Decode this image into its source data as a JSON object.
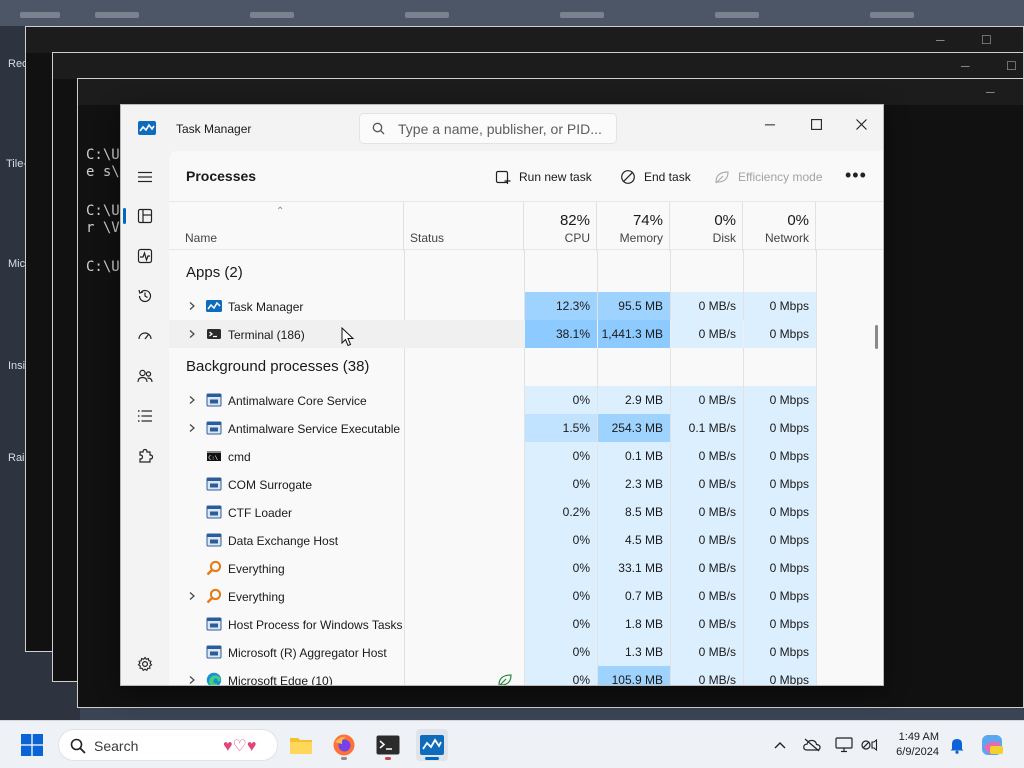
{
  "background": {
    "desktop_labels": [
      "Recycle",
      "Tile-Gr",
      "Micro",
      "Insi",
      "Rai"
    ],
    "terminal_lines": [
      "C:\\U",
      "e s\\",
      "C:\\U",
      "r \\V",
      "C:\\U"
    ]
  },
  "window": {
    "title": "Task Manager",
    "search_placeholder": "Type a name, publisher, or PID..."
  },
  "page": {
    "title": "Processes",
    "commands": {
      "run_new_task": "Run new task",
      "end_task": "End task",
      "efficiency_mode": "Efficiency mode"
    }
  },
  "columns": {
    "name": "Name",
    "status": "Status",
    "cpu": {
      "pct": "82%",
      "label": "CPU"
    },
    "memory": {
      "pct": "74%",
      "label": "Memory"
    },
    "disk": {
      "pct": "0%",
      "label": "Disk"
    },
    "network": {
      "pct": "0%",
      "label": "Network"
    }
  },
  "groups": {
    "apps": "Apps (2)",
    "background": "Background processes (38)"
  },
  "apps": [
    {
      "name": "Task Manager",
      "cpu": "12.3%",
      "memory": "95.5 MB",
      "disk": "0 MB/s",
      "network": "0 Mbps",
      "icon": "task-manager-icon"
    },
    {
      "name": "Terminal (186)",
      "cpu": "38.1%",
      "memory": "1,441.3 MB",
      "disk": "0 MB/s",
      "network": "0 Mbps",
      "icon": "terminal-icon"
    }
  ],
  "background_processes": [
    {
      "name": "Antimalware Core Service",
      "cpu": "0%",
      "memory": "2.9 MB",
      "disk": "0 MB/s",
      "network": "0 Mbps",
      "expandable": true,
      "icon": "app-window-icon"
    },
    {
      "name": "Antimalware Service Executable",
      "cpu": "1.5%",
      "memory": "254.3 MB",
      "disk": "0.1 MB/s",
      "network": "0 Mbps",
      "expandable": true,
      "icon": "app-window-icon"
    },
    {
      "name": "cmd",
      "cpu": "0%",
      "memory": "0.1 MB",
      "disk": "0 MB/s",
      "network": "0 Mbps",
      "expandable": false,
      "icon": "cmd-icon"
    },
    {
      "name": "COM Surrogate",
      "cpu": "0%",
      "memory": "2.3 MB",
      "disk": "0 MB/s",
      "network": "0 Mbps",
      "expandable": false,
      "icon": "app-window-icon"
    },
    {
      "name": "CTF Loader",
      "cpu": "0.2%",
      "memory": "8.5 MB",
      "disk": "0 MB/s",
      "network": "0 Mbps",
      "expandable": false,
      "icon": "app-window-icon"
    },
    {
      "name": "Data Exchange Host",
      "cpu": "0%",
      "memory": "4.5 MB",
      "disk": "0 MB/s",
      "network": "0 Mbps",
      "expandable": false,
      "icon": "app-window-icon"
    },
    {
      "name": "Everything",
      "cpu": "0%",
      "memory": "33.1 MB",
      "disk": "0 MB/s",
      "network": "0 Mbps",
      "expandable": false,
      "icon": "everything-search-icon"
    },
    {
      "name": "Everything",
      "cpu": "0%",
      "memory": "0.7 MB",
      "disk": "0 MB/s",
      "network": "0 Mbps",
      "expandable": true,
      "icon": "everything-search-icon"
    },
    {
      "name": "Host Process for Windows Tasks",
      "cpu": "0%",
      "memory": "1.8 MB",
      "disk": "0 MB/s",
      "network": "0 Mbps",
      "expandable": false,
      "icon": "app-window-icon"
    },
    {
      "name": "Microsoft (R) Aggregator Host",
      "cpu": "0%",
      "memory": "1.3 MB",
      "disk": "0 MB/s",
      "network": "0 Mbps",
      "expandable": false,
      "icon": "app-window-icon"
    },
    {
      "name": "Microsoft Edge (10)",
      "cpu": "0%",
      "memory": "105.9 MB",
      "disk": "0 MB/s",
      "network": "0 Mbps",
      "expandable": true,
      "icon": "edge-icon",
      "status_icon": "efficiency-leaf-icon"
    }
  ],
  "taskbar": {
    "search_label": "Search",
    "clock_time": "1:49 AM",
    "clock_date": "6/9/2024"
  },
  "colors": {
    "accent": "#0067c0",
    "heat_low": "#dcefff",
    "heat_mid": "#c2e3ff",
    "heat_high": "#9fd3ff",
    "heat_max": "#8ccaff"
  }
}
